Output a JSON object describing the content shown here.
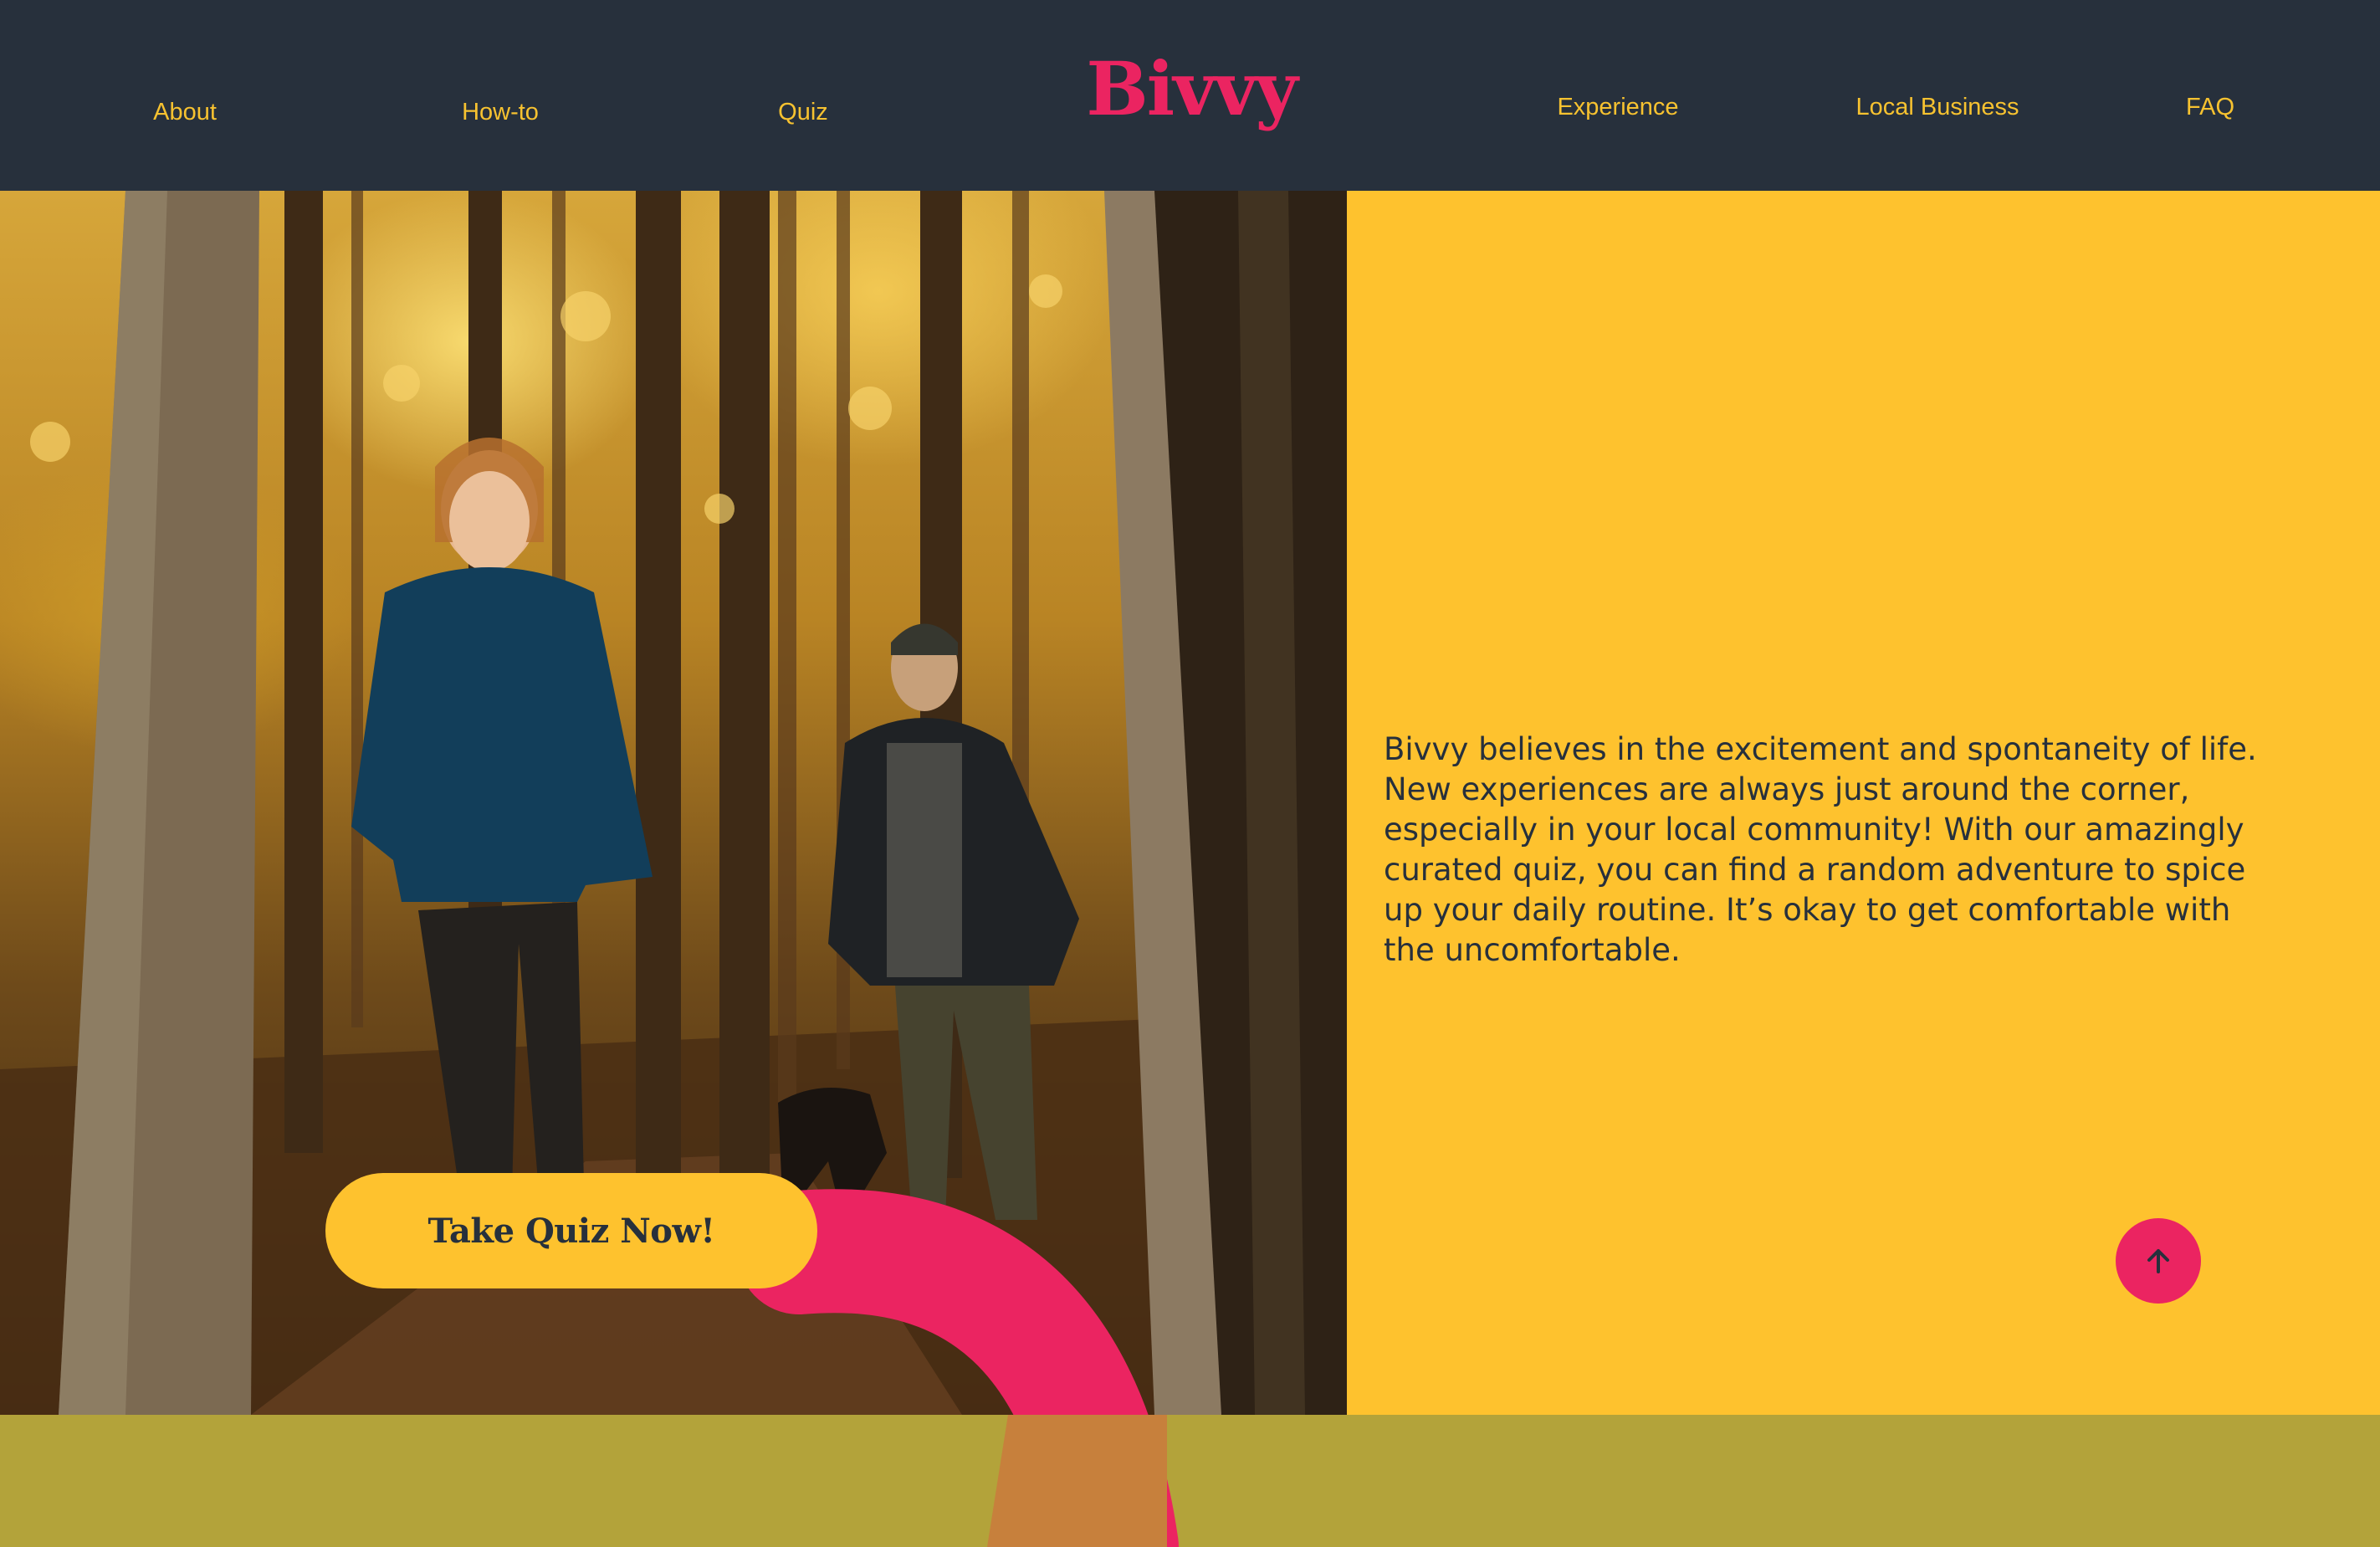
{
  "header": {
    "logo_text": "Bivvy",
    "nav_left": [
      {
        "label": "About"
      },
      {
        "label": "How-to"
      },
      {
        "label": "Quiz"
      }
    ],
    "nav_right": [
      {
        "label": "Experience"
      },
      {
        "label": "Local Business"
      },
      {
        "label": "FAQ"
      }
    ]
  },
  "hero": {
    "image_alt": "Two hikers walking with a dog on an autumn forest trail",
    "cta_label": "Take Quiz Now!"
  },
  "intro": {
    "text": "Bivvy believes in the excitement and spontaneity of life. New experiences are always just around the corner, especially in your local community! With our amazingly curated quiz, you can find a random adventure to spice up your daily routine. It’s okay to get comfortable with the uncomfortable."
  },
  "scroll_top": {
    "icon": "arrow-up-icon"
  },
  "colors": {
    "header_bg": "#27303C",
    "accent_pink": "#EB2461",
    "accent_yellow": "#FEC22E",
    "nav_text": "#F7C230",
    "olive": "#B3A33A",
    "text_dark": "#27303C"
  }
}
